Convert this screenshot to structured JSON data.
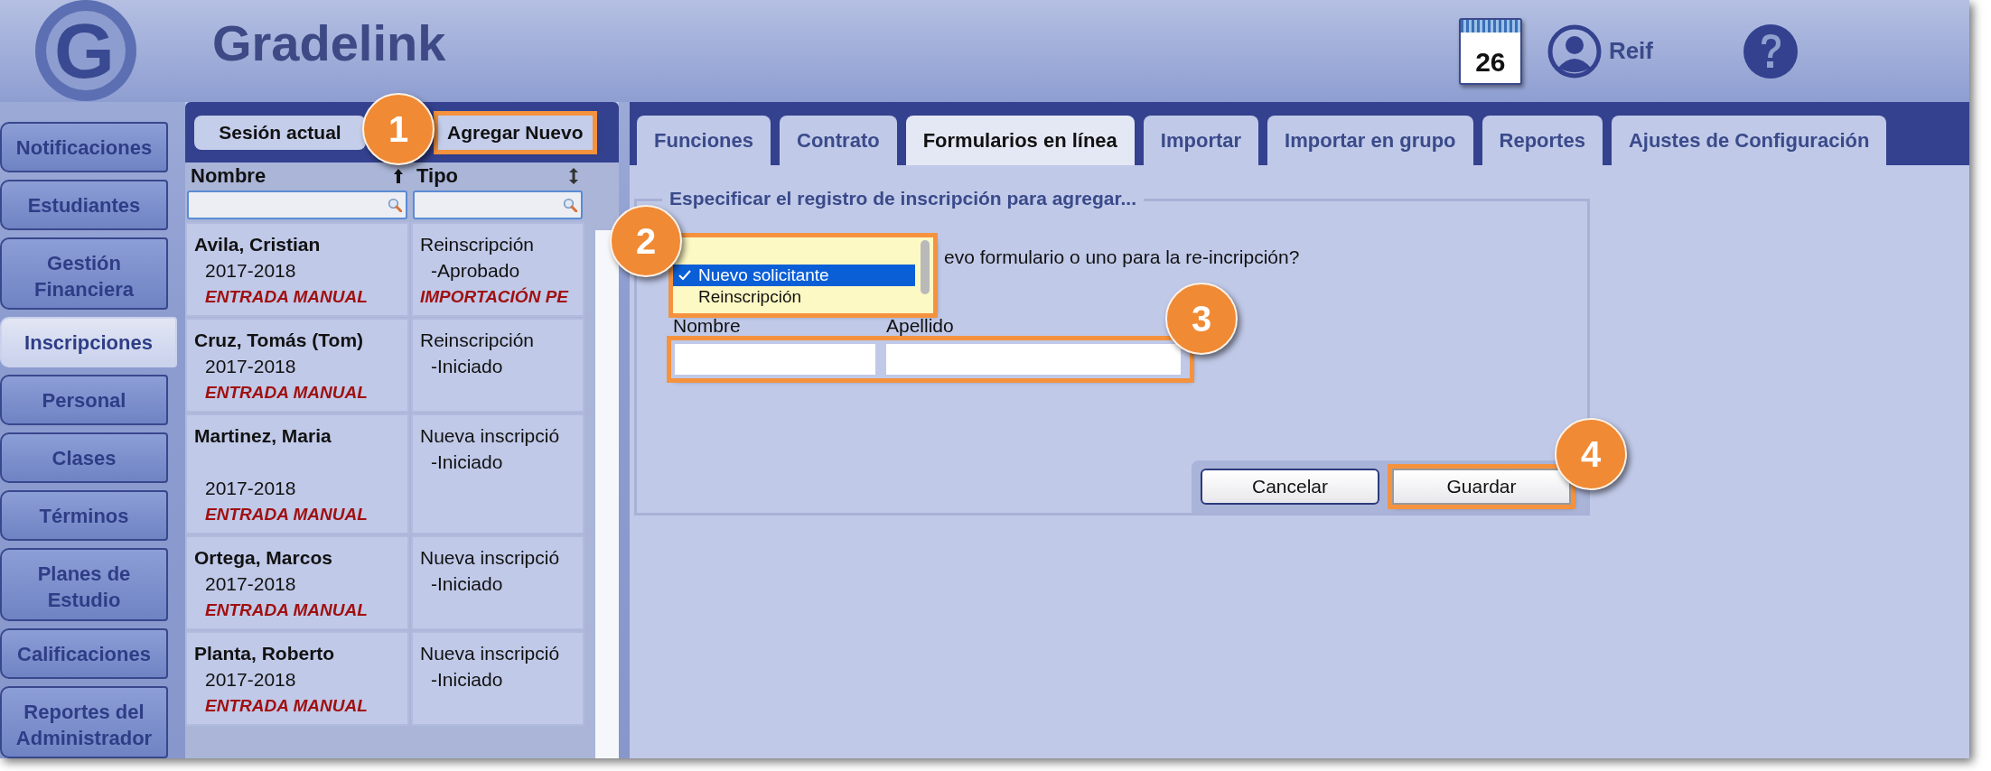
{
  "header": {
    "logo_letter": "G",
    "brand": "Gradelink",
    "calendar_day": "26",
    "user": "Reif"
  },
  "nav": [
    {
      "label": "Notificaciones",
      "selected": false
    },
    {
      "label": "Estudiantes",
      "selected": false
    },
    {
      "label": "Gestión Financiera",
      "selected": false
    },
    {
      "label": "Inscripciones",
      "selected": true
    },
    {
      "label": "Personal",
      "selected": false
    },
    {
      "label": "Clases",
      "selected": false
    },
    {
      "label": "Términos",
      "selected": false
    },
    {
      "label": "Planes de Estudio",
      "selected": false
    },
    {
      "label": "Calificaciones",
      "selected": false
    },
    {
      "label": "Reportes del Administrador",
      "selected": false
    }
  ],
  "list_panel": {
    "buttons": [
      {
        "label": "Sesión actual"
      },
      {
        "label": "Agregar Nuevo",
        "callout": "1"
      }
    ],
    "columns": [
      {
        "label": "Nombre",
        "kind": "sorted"
      },
      {
        "label": "Tipo",
        "kind": "sortable"
      }
    ],
    "rows": [
      {
        "name": "Avila, Cristian",
        "blank_line": false,
        "year": "2017-2018",
        "source": "ENTRADA MANUAL",
        "type": "Reinscripción",
        "status": "-Aprobado",
        "note": "IMPORTACIÓN PE"
      },
      {
        "name": "Cruz, Tomás (Tom)",
        "blank_line": false,
        "year": "2017-2018",
        "source": "ENTRADA MANUAL",
        "type": "Reinscripción",
        "status": "-Iniciado"
      },
      {
        "name": "Martinez, Maria",
        "blank_line": true,
        "year": "2017-2018",
        "source": "ENTRADA MANUAL",
        "type": "Nueva inscripció",
        "status": "-Iniciado"
      },
      {
        "name": "Ortega, Marcos",
        "blank_line": false,
        "year": "2017-2018",
        "source": "ENTRADA MANUAL",
        "type": "Nueva inscripció",
        "status": "-Iniciado"
      },
      {
        "name": "Planta, Roberto",
        "blank_line": false,
        "year": "2017-2018",
        "source": "ENTRADA MANUAL",
        "type": "Nueva inscripció",
        "status": "-Iniciado"
      }
    ]
  },
  "tabs": [
    {
      "label": "Funciones",
      "selected": false
    },
    {
      "label": "Contrato",
      "selected": false
    },
    {
      "label": "Formularios en línea",
      "selected": true
    },
    {
      "label": "Importar",
      "selected": false
    },
    {
      "label": "Importar en grupo",
      "selected": false
    },
    {
      "label": "Reportes",
      "selected": false
    },
    {
      "label": "Ajustes de Configuración",
      "selected": false
    }
  ],
  "form": {
    "legend": "Especificar el registro de inscripción para agregar...",
    "question": "evo formulario o uno para la re-incripción?",
    "dropdown": {
      "callout": "2",
      "options": [
        {
          "label": "Nuevo solicitante",
          "selected": true
        },
        {
          "label": "Reinscripción",
          "selected": false
        }
      ]
    },
    "fields": {
      "callout": "3",
      "items": [
        {
          "label": "Nombre"
        },
        {
          "label": "Apellido"
        }
      ]
    },
    "buttons": [
      {
        "label": "Cancelar"
      },
      {
        "label": "Guardar",
        "callout": "4"
      }
    ]
  }
}
